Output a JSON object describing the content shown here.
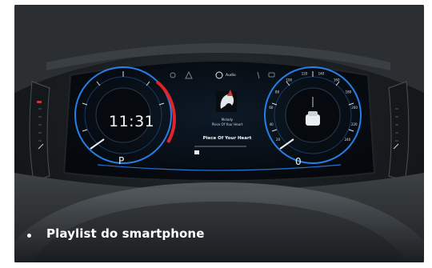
{
  "caption": {
    "text": "Playlist do smartphone"
  },
  "cluster": {
    "clock": "11:31",
    "gear": "P",
    "speed": "0",
    "audio_label": "Audio",
    "artist": "Melody",
    "song_small": "Piece Of Your Heart",
    "song_big": "Piece Of Your Heart",
    "speed_ticks": [
      "20",
      "40",
      "60",
      "80",
      "100",
      "120",
      "140",
      "160",
      "180",
      "200",
      "220",
      "240"
    ]
  },
  "colors": {
    "gauge_blue": "#2a8cff",
    "gauge_red": "#e0242b",
    "dark_bg": "#0d1013",
    "caption_text": "#ffffff"
  }
}
